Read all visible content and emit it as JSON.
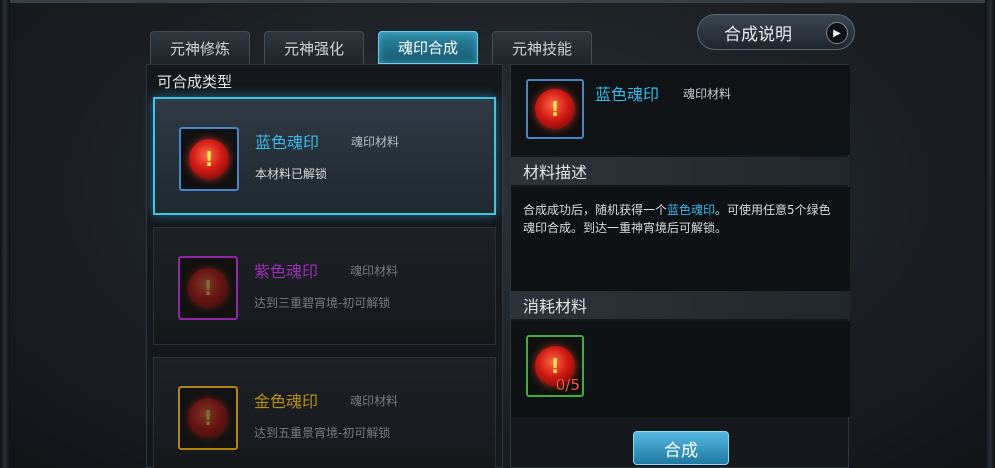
{
  "tabs": [
    {
      "label": "元神修炼"
    },
    {
      "label": "元神强化"
    },
    {
      "label": "魂印合成",
      "active": true
    },
    {
      "label": "元神技能"
    }
  ],
  "help_button": {
    "label": "合成说明"
  },
  "left": {
    "title": "可合成类型",
    "items": [
      {
        "name": "蓝色魂印",
        "kind": "魂印材料",
        "desc": "本材料已解锁",
        "name_color": "#3bb8ea",
        "frame_color": "#4586c9"
      },
      {
        "name": "紫色魂印",
        "kind": "魂印材料",
        "desc": "达到三重碧宵境-初可解锁",
        "name_color": "#b13ccf",
        "frame_color": "#8e2aa6"
      },
      {
        "name": "金色魂印",
        "kind": "魂印材料",
        "desc": "达到五重景宵境-初可解锁",
        "name_color": "#c79b1f",
        "frame_color": "#b0860f"
      }
    ]
  },
  "detail": {
    "name": "蓝色魂印",
    "kind": "魂印材料",
    "section_desc": "材料描述",
    "desc_before": "合成成功后，随机获得一个",
    "desc_highlight": "蓝色魂印",
    "desc_after": "。可使用任意5个绿色魂印合成。到达一重神宵境后可解锁。",
    "section_cost": "消耗材料",
    "cost_count": "0/5",
    "combine_label": "合成"
  }
}
